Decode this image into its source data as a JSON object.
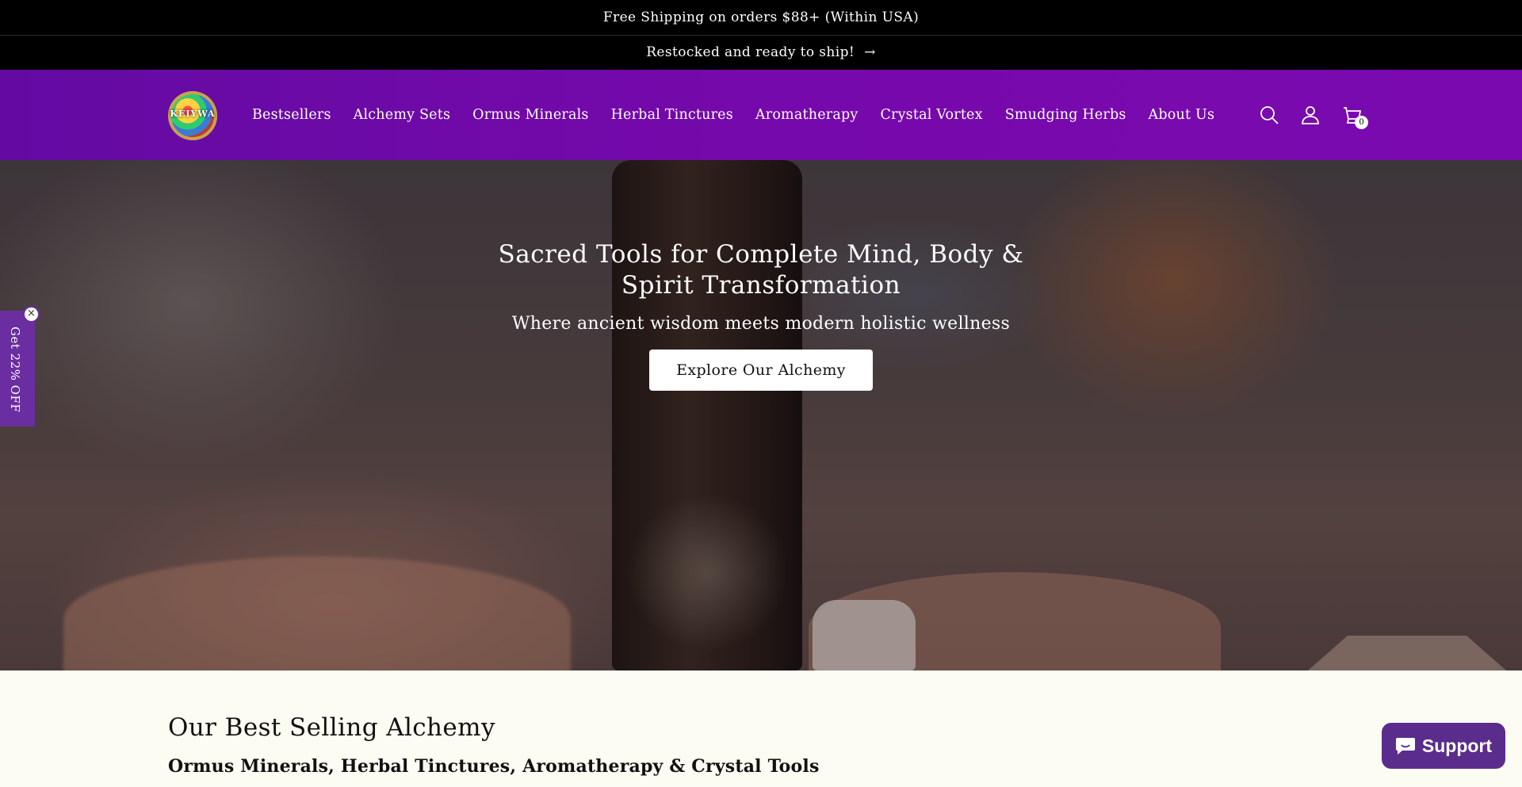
{
  "announcement": {
    "shipping": "Free Shipping on orders $88+ (Within USA)",
    "restock": "Restocked and ready to ship!",
    "restock_arrow": "→"
  },
  "header": {
    "logo_text": "KEIYWA",
    "nav": [
      {
        "label": "Bestsellers"
      },
      {
        "label": "Alchemy Sets"
      },
      {
        "label": "Ormus Minerals"
      },
      {
        "label": "Herbal Tinctures"
      },
      {
        "label": "Aromatherapy"
      },
      {
        "label": "Crystal Vortex"
      },
      {
        "label": "Smudging Herbs"
      },
      {
        "label": "About Us"
      }
    ],
    "icons": [
      "search-icon",
      "account-icon",
      "cart-icon"
    ],
    "cart_count": "0",
    "bg_color": "#7609ab"
  },
  "hero": {
    "title": "Sacred Tools for Complete Mind, Body & Spirit Transformation",
    "subtitle": "Where ancient wisdom meets modern holistic wellness",
    "cta_label": "Explore Our Alchemy"
  },
  "popup": {
    "label": "Get 22% OFF",
    "close": "×"
  },
  "bestsellers": {
    "heading": "Our Best Selling Alchemy",
    "subheading": "Ormus Minerals, Herbal Tinctures, Aromatherapy & Crystal Tools"
  },
  "support": {
    "label": "Support",
    "color": "#5a2d8c"
  }
}
